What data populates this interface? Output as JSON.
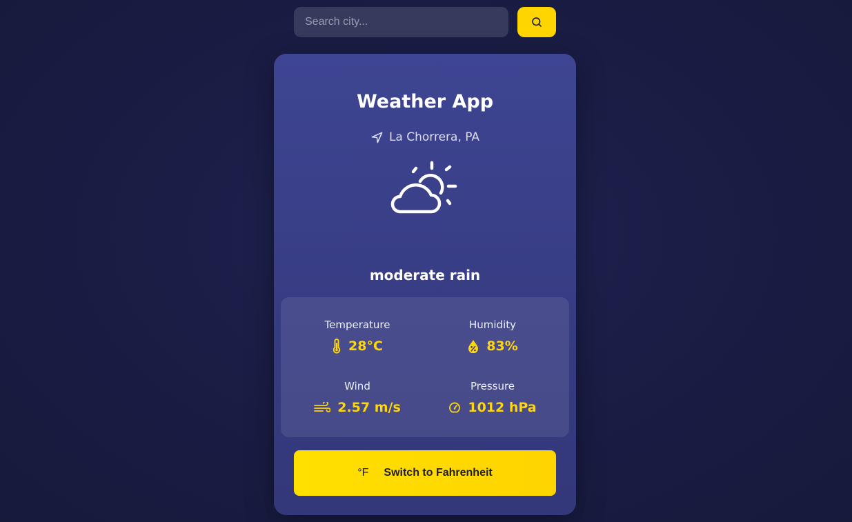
{
  "search": {
    "placeholder": "Search city...",
    "value": "",
    "button_icon": "search-icon"
  },
  "card": {
    "title": "Weather App",
    "location": "La Chorrera, PA",
    "location_icon": "navigation-arrow-icon",
    "condition_icon": "partly-cloudy-icon",
    "description": "moderate rain"
  },
  "stats": {
    "temperature": {
      "label": "Temperature",
      "value": "28°C",
      "icon": "thermometer-icon"
    },
    "humidity": {
      "label": "Humidity",
      "value": "83%",
      "icon": "humidity-drop-icon"
    },
    "wind": {
      "label": "Wind",
      "value": "2.57 m/s",
      "icon": "wind-icon"
    },
    "pressure": {
      "label": "Pressure",
      "value": "1012 hPa",
      "icon": "gauge-icon"
    }
  },
  "unit_toggle": {
    "icon_text": "°F",
    "label": "Switch to Fahrenheit"
  },
  "colors": {
    "accent": "#ffd500",
    "card": "#3a4089",
    "background": "#1a1d45"
  }
}
